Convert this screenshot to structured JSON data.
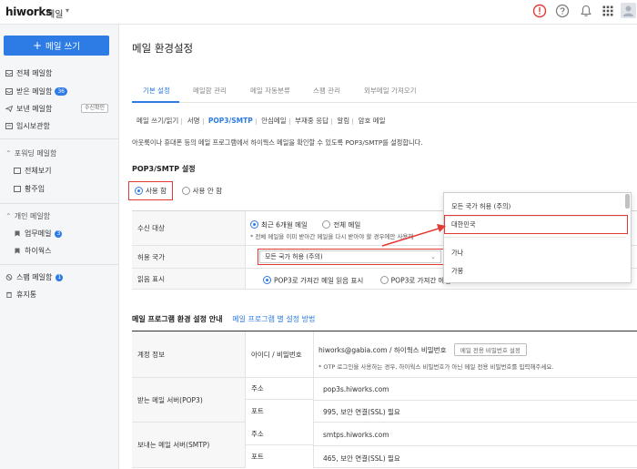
{
  "topbar": {
    "logo": "hiworks",
    "app_name": "메일",
    "caret": "▾"
  },
  "sidebar": {
    "compose_label": "메일 쓰기",
    "items": [
      {
        "label": "전체 메일함"
      },
      {
        "label": "받은 메일함",
        "badge": "36"
      },
      {
        "label": "보낸 메일함",
        "chip": "수신확인"
      },
      {
        "label": "임시보관함"
      }
    ],
    "forwarding": {
      "title": "포워딩 메일함",
      "items": [
        "전체보기",
        "황주임"
      ]
    },
    "personal": {
      "title": "개인 메일함",
      "items": [
        {
          "label": "업무메일",
          "badge": "3"
        },
        {
          "label": "하이웍스"
        }
      ]
    },
    "spam": {
      "label": "스팸 메일함",
      "badge": "1"
    },
    "trash": {
      "label": "휴지통"
    }
  },
  "main": {
    "title": "메일 환경설정",
    "tabs": [
      "기본 설정",
      "메일함 관리",
      "메일 자동분류",
      "스팸 관리",
      "외부메일 가져오기"
    ],
    "subtabs": [
      "메일 쓰기/읽기",
      "서명",
      "POP3/SMTP",
      "안심메일",
      "부재중 응답",
      "알림",
      "암호 메일"
    ],
    "description": "아웃룩이나 휴대폰 등의 메일 프로그램에서 하이웍스 메일을 확인할 수 있도록 POP3/SMTP를 설정합니다.",
    "pop3": {
      "title": "POP3/SMTP 설정",
      "use": "사용 함",
      "unuse": "사용 안 함",
      "receive_target_label": "수신 대상",
      "recent_6m": "최근 6개월 메일",
      "all_mail": "전체 메일",
      "receive_note": "* 전체 메일을 이미 받아간 메일을 다시 받아야 할 경우에만 사용해",
      "country_label": "허용 국가",
      "country_value": "모든 국가 허용 (주의)",
      "read_label": "읽음 표시",
      "read_opt1": "POP3로 가져간 메일 읽음 표시",
      "read_opt2": "POP3로 가져간 메일"
    },
    "program": {
      "title": "메일 프로그램 환경 설정 안내",
      "link": "메일 프로그램 별 설정 방법",
      "account_label": "계정 정보",
      "account_sub": "아이디 / 비밀번호",
      "account_value": "hiworks@gabia.com / 하이웍스 비밀번호",
      "account_btn": "메일 전용 비밀번호 설정",
      "account_note": "* OTP 로그인을 사용하는 경우, 하이웍스 비밀번호가 아닌 메일 전용 비밀번호를 입력해주세요.",
      "pop3_label": "받는 메일 서버(POP3)",
      "addr_label": "주소",
      "port_label": "포트",
      "pop3_addr": "pop3s.hiworks.com",
      "pop3_port": "995, 보안 연결(SSL) 필요",
      "smtp_label": "보내는 메일 서버(SMTP)",
      "smtp_addr": "smtps.hiworks.com",
      "smtp_port": "465, 보안 연결(SSL) 필요"
    }
  },
  "dropdown": {
    "options": [
      "모든 국가 허용 (주의)",
      "대한민국",
      "가나",
      "가봉"
    ]
  },
  "colors": {
    "accent": "#2d7be5",
    "highlight": "#e53935",
    "alert": "#e53935"
  }
}
